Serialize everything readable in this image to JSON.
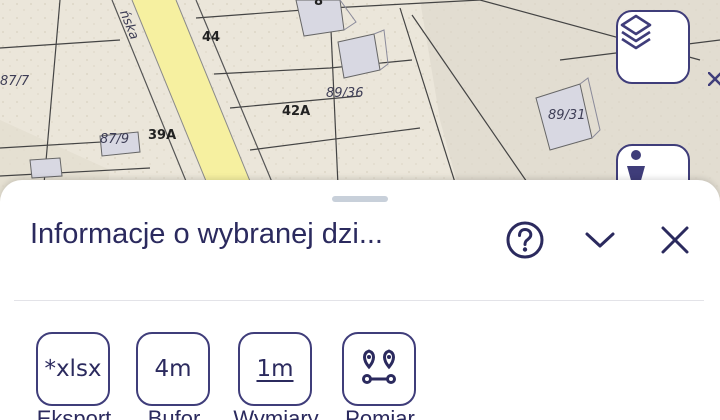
{
  "map": {
    "street_label": "ńska",
    "labels": {
      "l_44": "44",
      "l_87_7": "87/7",
      "l_89_36": "89/36",
      "l_42a": "42A",
      "l_89_31": "89/31",
      "l_87_9": "87/9",
      "l_39a": "39A",
      "l_8": "8"
    },
    "icons": {
      "layers": "layers-icon",
      "accessibility": "person-icon"
    }
  },
  "sheet": {
    "title": "Informacje o wybranej dzi...",
    "help_icon": "help-circle-icon",
    "collapse_icon": "chevron-down-icon",
    "close_icon": "close-icon"
  },
  "tools": [
    {
      "text": "*xlsx",
      "label": "Eksport"
    },
    {
      "text": "4m",
      "label": "Bufor"
    },
    {
      "text": "1m",
      "label": "Wymiary"
    },
    {
      "text": "",
      "label": "Pomiar"
    }
  ],
  "colors": {
    "accent": "#3f3d7a",
    "text": "#2b2a5e",
    "road": "#f6f0a0"
  }
}
